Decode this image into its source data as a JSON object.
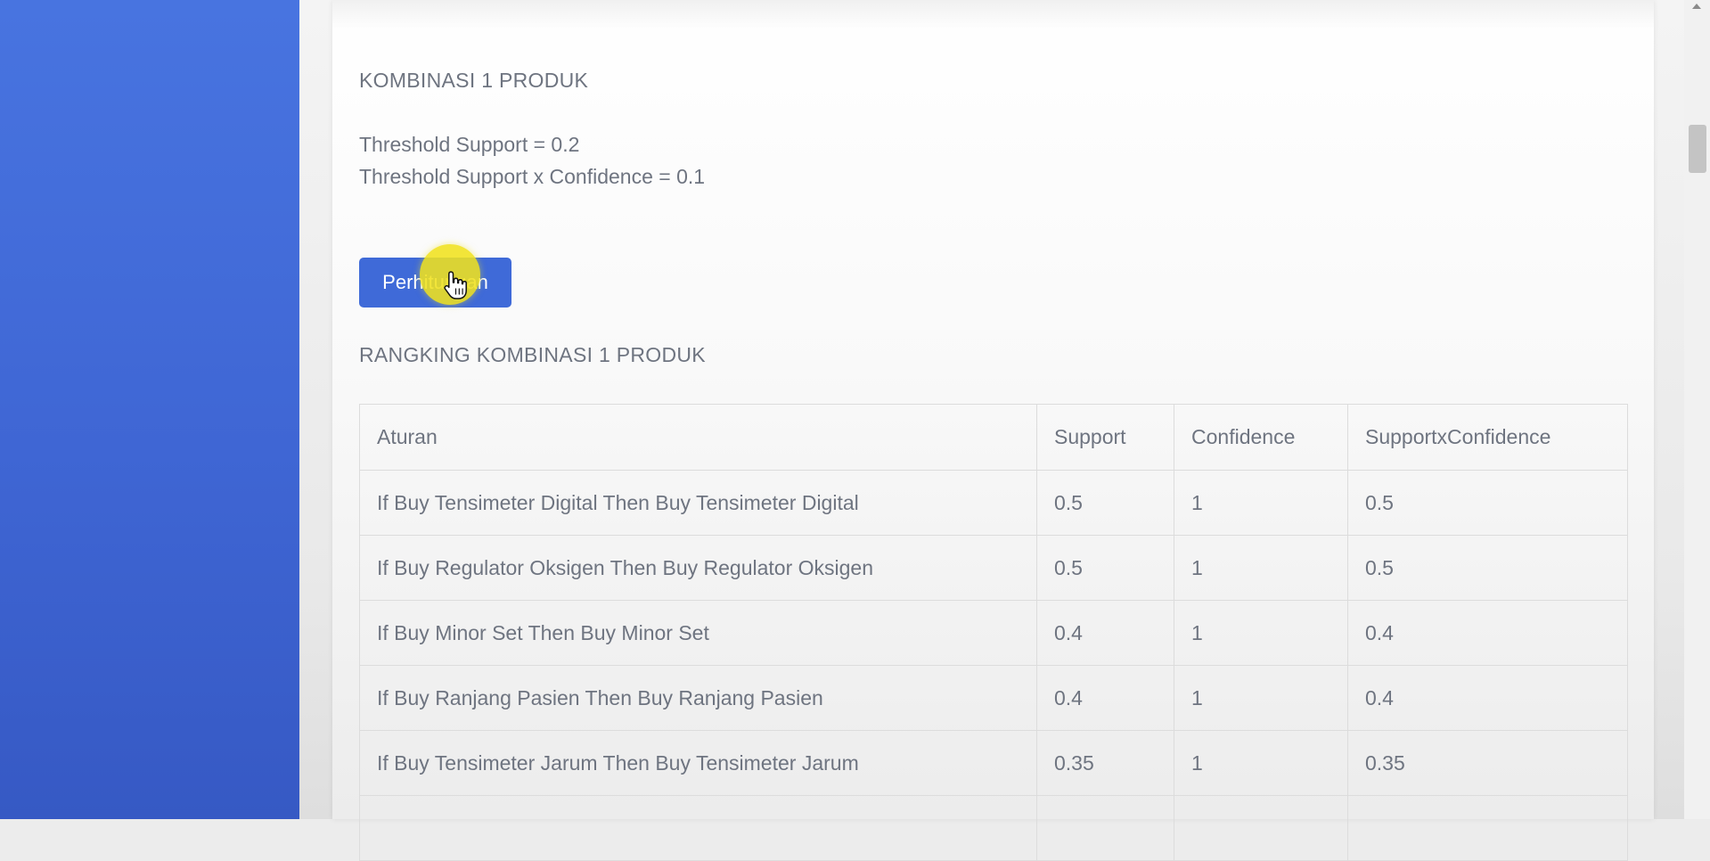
{
  "section": {
    "heading": "KOMBINASI 1 PRODUK",
    "threshold_support": "Threshold Support = 0.2",
    "threshold_support_confidence": "Threshold Support x Confidence = 0.1",
    "button_label": "Perhitungan",
    "ranking_heading": "RANGKING KOMBINASI 1 PRODUK"
  },
  "table": {
    "headers": [
      "Aturan",
      "Support",
      "Confidence",
      "SupportxConfidence"
    ],
    "rows": [
      [
        "If Buy Tensimeter Digital Then Buy Tensimeter Digital",
        "0.5",
        "1",
        "0.5"
      ],
      [
        "If Buy Regulator Oksigen Then Buy Regulator Oksigen",
        "0.5",
        "1",
        "0.5"
      ],
      [
        "If Buy Minor Set Then Buy Minor Set",
        "0.4",
        "1",
        "0.4"
      ],
      [
        "If Buy Ranjang Pasien Then Buy Ranjang Pasien",
        "0.4",
        "1",
        "0.4"
      ],
      [
        "If Buy Tensimeter Jarum Then Buy Tensimeter Jarum",
        "0.35",
        "1",
        "0.35"
      ],
      [
        "",
        "",
        "",
        ""
      ]
    ]
  },
  "colors": {
    "sidebar": "#4470dd",
    "button": "#3f6ad8",
    "cursor_highlight": "#f0e11e",
    "text": "#6e7480"
  },
  "icons": {
    "cursor": "hand-pointer-icon",
    "scroll_up": "scroll-up-arrow-icon"
  }
}
